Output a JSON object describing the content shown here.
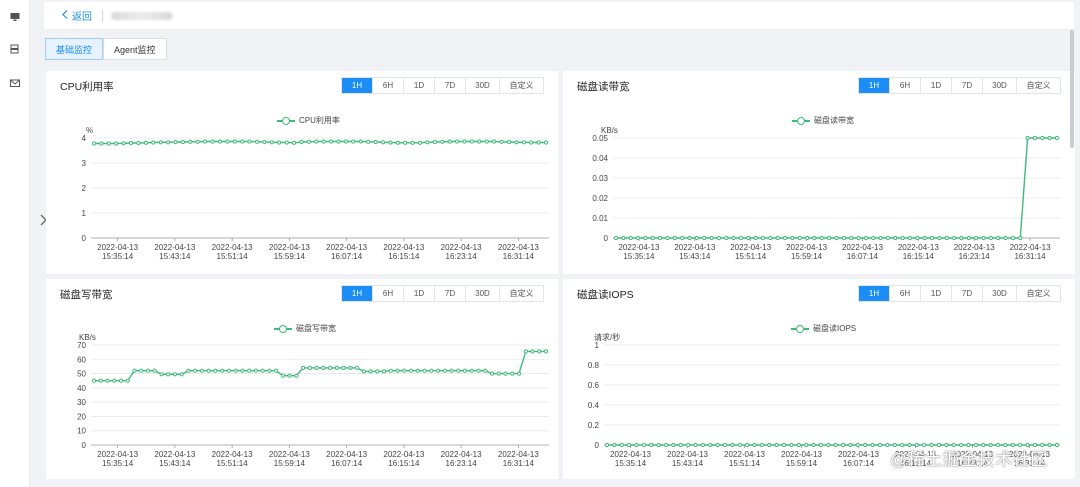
{
  "topbar": {
    "back_label": "返回"
  },
  "tabs": [
    {
      "label": "基础监控",
      "active": true
    },
    {
      "label": "Agent监控",
      "active": false
    }
  ],
  "range_options": [
    "1H",
    "6H",
    "1D",
    "7D",
    "30D",
    "自定义"
  ],
  "colors": {
    "accent": "#1b8df4",
    "series": "#3dbb78"
  },
  "icons": [
    "monitor-icon",
    "server-icon",
    "mail-icon",
    "chevron-right-icon",
    "chevron-left-icon"
  ],
  "panels": [
    {
      "title": "CPU利用率",
      "legend": "CPU利用率",
      "active_range": "1H"
    },
    {
      "title": "磁盘读带宽",
      "legend": "磁盘读带宽",
      "active_range": "1H"
    },
    {
      "title": "磁盘写带宽",
      "legend": "磁盘写带宽",
      "active_range": "1H"
    },
    {
      "title": "磁盘读IOPS",
      "legend": "磁盘读IOPS",
      "active_range": "1H"
    }
  ],
  "watermark": "@稀土掘金技术社区",
  "chart_data": [
    {
      "type": "line",
      "ylabel": "%",
      "ylim": [
        0,
        4
      ],
      "yticks": [
        0,
        1,
        2,
        3,
        4
      ],
      "xticks": [
        "2022-04-13 15:35:14",
        "2022-04-13 15:43:14",
        "2022-04-13 15:51:14",
        "2022-04-13 15:59:14",
        "2022-04-13 16:07:14",
        "2022-04-13 16:15:14",
        "2022-04-13 16:23:14",
        "2022-04-13 16:31:14"
      ],
      "grid": true,
      "legend_position": "top-center",
      "series": [
        {
          "name": "CPU利用率",
          "values": [
            3.78,
            3.78,
            3.78,
            3.78,
            3.79,
            3.8,
            3.8,
            3.81,
            3.82,
            3.83,
            3.83,
            3.84,
            3.84,
            3.85,
            3.85,
            3.86,
            3.86,
            3.86,
            3.86,
            3.86,
            3.86,
            3.86,
            3.85,
            3.84,
            3.83,
            3.82,
            3.82,
            3.81,
            3.84,
            3.85,
            3.86,
            3.86,
            3.86,
            3.86,
            3.86,
            3.86,
            3.86,
            3.85,
            3.84,
            3.83,
            3.82,
            3.81,
            3.81,
            3.81,
            3.81,
            3.83,
            3.84,
            3.85,
            3.86,
            3.86,
            3.86,
            3.86,
            3.86,
            3.86,
            3.86,
            3.85,
            3.84,
            3.83,
            3.83,
            3.82,
            3.82,
            3.82
          ]
        }
      ]
    },
    {
      "type": "line",
      "ylabel": "KB/s",
      "ylim": [
        0,
        0.05
      ],
      "yticks": [
        0,
        0.01,
        0.02,
        0.03,
        0.04,
        0.05
      ],
      "xticks": [
        "2022-04-13 15:35:14",
        "2022-04-13 15:43:14",
        "2022-04-13 15:51:14",
        "2022-04-13 15:59:14",
        "2022-04-13 16:07:14",
        "2022-04-13 16:15:14",
        "2022-04-13 16:23:14",
        "2022-04-13 16:31:14"
      ],
      "grid": true,
      "legend_position": "top-center",
      "series": [
        {
          "name": "磁盘读带宽",
          "values": [
            0,
            0,
            0,
            0,
            0,
            0,
            0,
            0,
            0,
            0,
            0,
            0,
            0,
            0,
            0,
            0,
            0,
            0,
            0,
            0,
            0,
            0,
            0,
            0,
            0,
            0,
            0,
            0,
            0,
            0,
            0,
            0,
            0,
            0,
            0,
            0,
            0,
            0,
            0,
            0,
            0,
            0,
            0,
            0,
            0,
            0,
            0,
            0,
            0,
            0,
            0,
            0,
            0,
            0,
            0,
            0,
            0.05,
            0.05,
            0.05,
            0.05,
            0.05
          ]
        }
      ]
    },
    {
      "type": "line",
      "ylabel": "KB/s",
      "ylim": [
        0,
        70
      ],
      "yticks": [
        0,
        10,
        20,
        30,
        40,
        50,
        60,
        70
      ],
      "xticks": [
        "2022-04-13 15:35:14",
        "2022-04-13 15:43:14",
        "2022-04-13 15:51:14",
        "2022-04-13 15:59:14",
        "2022-04-13 16:07:14",
        "2022-04-13 16:15:14",
        "2022-04-13 16:23:14",
        "2022-04-13 16:31:14"
      ],
      "grid": true,
      "legend_position": "top-center",
      "series": [
        {
          "name": "磁盘写带宽",
          "values": [
            45,
            45,
            45,
            45,
            45,
            45,
            52,
            52,
            52,
            52,
            49.5,
            49.5,
            49.5,
            49.5,
            52,
            52,
            52,
            52,
            52,
            52,
            52,
            52,
            52,
            52,
            52,
            52,
            52,
            52,
            48.5,
            48.5,
            48.5,
            54,
            54,
            54,
            54,
            54,
            54,
            54,
            54,
            54,
            51.5,
            51.5,
            51.5,
            51.5,
            52,
            52,
            52,
            52,
            52,
            52,
            52,
            52,
            52,
            52,
            52,
            52,
            52,
            52,
            52,
            50,
            50,
            50,
            50,
            50,
            65.5,
            65.5,
            65.5,
            65.5
          ]
        }
      ]
    },
    {
      "type": "line",
      "ylabel": "请求/秒",
      "ylim": [
        0,
        1
      ],
      "yticks": [
        0,
        0.2,
        0.4,
        0.6,
        0.8,
        1
      ],
      "xticks": [
        "2022-04-13 15:35:14",
        "2022-04-13 15:43:14",
        "2022-04-13 15:51:14",
        "2022-04-13 15:59:14",
        "2022-04-13 16:07:14",
        "2022-04-13 16:15:14",
        "2022-04-13 16:23:14",
        "2022-04-13 16:31:14"
      ],
      "grid": true,
      "legend_position": "top-center",
      "series": [
        {
          "name": "磁盘读IOPS",
          "values": [
            0,
            0,
            0,
            0,
            0,
            0,
            0,
            0,
            0,
            0,
            0,
            0,
            0,
            0,
            0,
            0,
            0,
            0,
            0,
            0,
            0,
            0,
            0,
            0,
            0,
            0,
            0,
            0,
            0,
            0,
            0,
            0,
            0,
            0,
            0,
            0,
            0,
            0,
            0,
            0,
            0,
            0,
            0,
            0,
            0,
            0,
            0,
            0,
            0,
            0,
            0,
            0,
            0,
            0,
            0,
            0,
            0,
            0,
            0,
            0,
            0,
            0
          ]
        }
      ]
    }
  ]
}
